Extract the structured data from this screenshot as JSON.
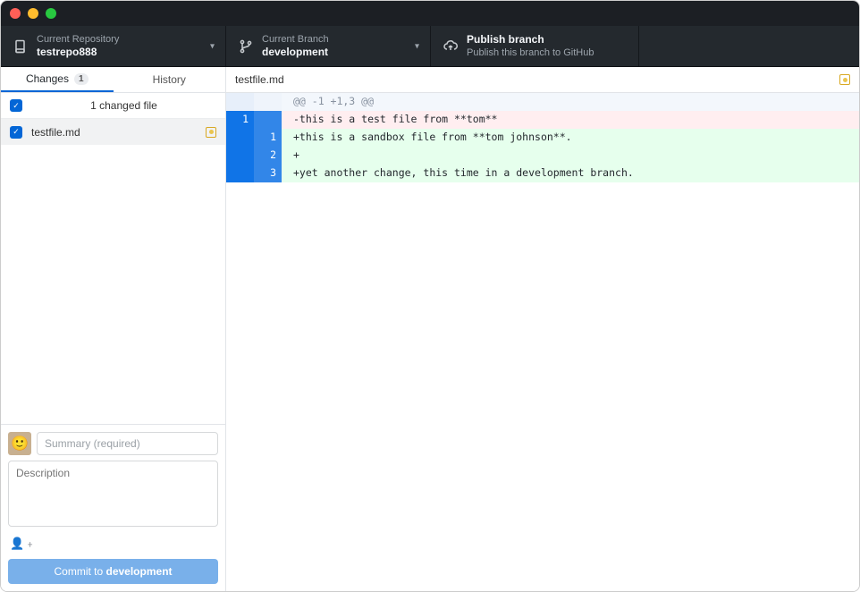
{
  "topbar": {
    "repo_label": "Current Repository",
    "repo_name": "testrepo888",
    "branch_label": "Current Branch",
    "branch_name": "development",
    "publish_title": "Publish branch",
    "publish_desc": "Publish this branch to GitHub"
  },
  "sidebar": {
    "tab_changes": "Changes",
    "changes_count": "1",
    "tab_history": "History",
    "changed_summary": "1 changed file",
    "file0": "testfile.md"
  },
  "commit": {
    "summary_placeholder": "Summary (required)",
    "desc_placeholder": "Description",
    "coauthor_glyph": "👤﹢",
    "button_prefix": "Commit to ",
    "button_branch": "development"
  },
  "diff": {
    "filename": "testfile.md",
    "hunk": "@@ -1 +1,3 @@",
    "l0_old": "1",
    "l0_txt": "-this is a test file from **tom**",
    "l1_new": "1",
    "l1_txt": "+this is a sandbox file from **tom johnson**.",
    "l2_new": "2",
    "l2_txt": "+",
    "l3_new": "3",
    "l3_txt": "+yet another change, this time in a development branch."
  }
}
